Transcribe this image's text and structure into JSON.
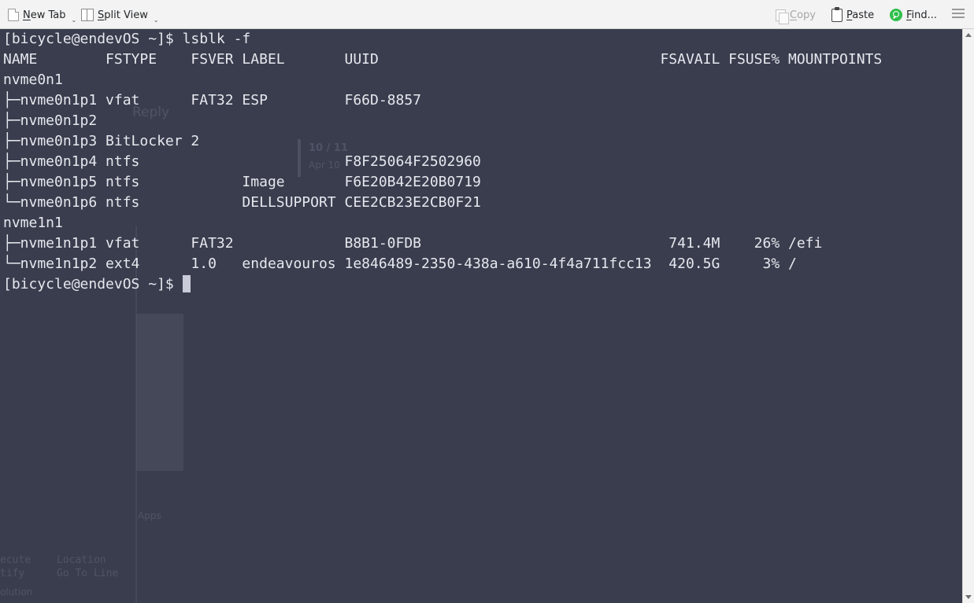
{
  "toolbar": {
    "new_tab": "New Tab",
    "split_view": "Split View",
    "copy": "Copy",
    "paste": "Paste",
    "find": "Find..."
  },
  "terminal": {
    "prompt": "[bicycle@endevOS ~]$ ",
    "command": "lsblk -f",
    "header": "NAME        FSTYPE    FSVER LABEL       UUID                                 FSAVAIL FSUSE% MOUNTPOINTS",
    "rows": [
      "nvme0n1",
      "├─nvme0n1p1 vfat      FAT32 ESP         F66D-8857",
      "├─nvme0n1p2",
      "├─nvme0n1p3 BitLocker 2",
      "├─nvme0n1p4 ntfs                        F8F25064F2502960",
      "├─nvme0n1p5 ntfs            Image       F6E20B42E20B0719",
      "└─nvme0n1p6 ntfs            DELLSUPPORT CEE2CB23E2CB0F21",
      "nvme1n1",
      "├─nvme1n1p1 vfat      FAT32             B8B1-0FDB                             741.4M    26% /efi",
      "└─nvme1n1p2 ext4      1.0   endeavouros 1e846489-2350-438a-a610-4f4a711fcc13  420.5G     3% /"
    ],
    "final_prompt": "[bicycle@endevOS ~]$ "
  },
  "background_ghost": {
    "reply": "Reply",
    "counter": "10 / 11",
    "apr": "Apr 10",
    "apps": "Apps",
    "location": "Location",
    "go_to_line": "Go To Line",
    "execute": "ecute",
    "notify": "tify",
    "solution": "olution"
  },
  "colors": {
    "terminal_bg": "#3a3d4e",
    "terminal_fg": "#e6e8ee",
    "toolbar_bg": "#f3f3f3",
    "find_icon": "#2fbf4a"
  }
}
